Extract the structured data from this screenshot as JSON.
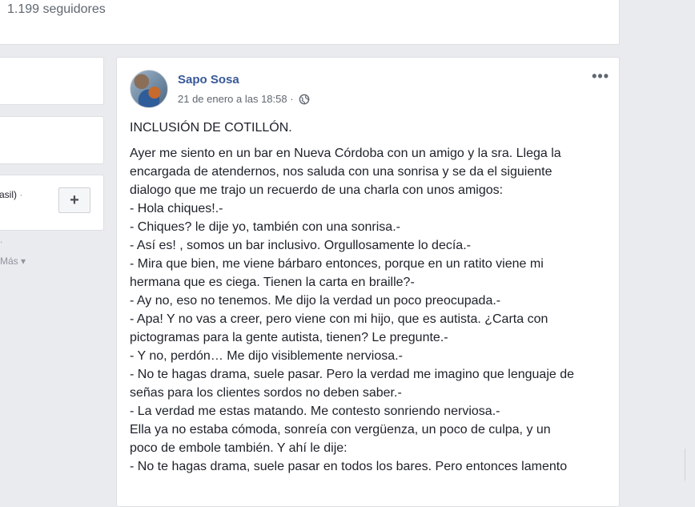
{
  "profile_header": {
    "followers_text": "1.199 seguidores"
  },
  "sidebar": {
    "box3_text": "rasil)",
    "box3_dot": "·",
    "add_label": "+",
    "dot": ".",
    "more_text": "Más ▾"
  },
  "post": {
    "author": "Sapo Sosa",
    "date": "21 de enero a las 18:58",
    "separator": "·",
    "options_label": "•••",
    "title": "INCLUSIÓN DE COTILLÓN.",
    "lines": [
      "Ayer me siento en un bar en Nueva Córdoba con un amigo y la sra. Llega la",
      "encargada de atendernos, nos saluda con una sonrisa y se da el siguiente",
      "dialogo que me trajo un recuerdo de una charla con unos amigos:",
      "- Hola chiques!.-",
      "- Chiques? le dije yo, también con una sonrisa.-",
      "- Así es! , somos un bar inclusivo. Orgullosamente lo decía.-",
      "- Mira que bien, me viene bárbaro entonces, porque en un ratito viene mi",
      "hermana que es ciega. Tienen la carta en braille?-",
      "- Ay no, eso no tenemos. Me dijo la verdad un poco preocupada.-",
      "- Apa! Y no vas a creer, pero viene con mi hijo, que es autista. ¿Carta con",
      "pictogramas para la gente autista, tienen? Le pregunte.-",
      "- Y no, perdón… Me dijo visiblemente nerviosa.-",
      "- No te hagas drama, suele pasar. Pero la verdad me imagino que lenguaje de",
      "señas para los clientes sordos no deben saber.-",
      "- La verdad me estas matando. Me contesto sonriendo nerviosa.-",
      "Ella ya no estaba cómoda, sonreía con vergüenza, un poco de culpa, y un",
      "poco de embole también. Y ahí le dije:",
      "- No te hagas drama, suele pasar en todos los bares. Pero entonces lamento"
    ]
  }
}
